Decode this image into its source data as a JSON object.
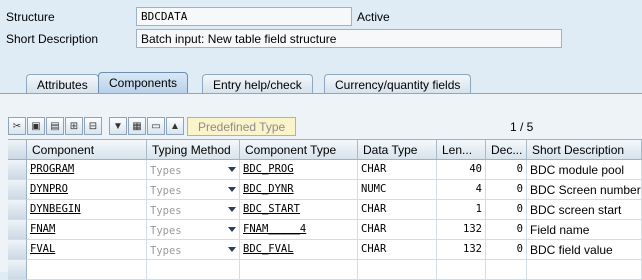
{
  "header": {
    "structure_label": "Structure",
    "structure_value": "BDCDATA",
    "status": "Active",
    "short_desc_label": "Short Description",
    "short_desc_value": "Batch input: New table field structure"
  },
  "tabs": [
    {
      "label": "Attributes",
      "active": false
    },
    {
      "label": "Components",
      "active": true
    },
    {
      "label": "Entry help/check",
      "active": false
    },
    {
      "label": "Currency/quantity fields",
      "active": false
    }
  ],
  "toolbar": {
    "icons": [
      "cut-icon",
      "copy-icon",
      "paste-icon",
      "insert-row-icon",
      "delete-row-icon",
      "expand-icon",
      "select-all-icon",
      "deselect-icon",
      "collapse-icon"
    ],
    "predefined_type_label": "Predefined Type",
    "pager": "1 / 5"
  },
  "table": {
    "columns": [
      "Component",
      "Typing Method",
      "Component Type",
      "Data Type",
      "Len...",
      "Dec...",
      "Short Description"
    ],
    "rows": [
      {
        "component": "PROGRAM",
        "typing": "Types",
        "ctype": "BDC_PROG",
        "dtype": "CHAR",
        "len": "40",
        "dec": "0",
        "desc": "BDC module pool"
      },
      {
        "component": "DYNPRO",
        "typing": "Types",
        "ctype": "BDC_DYNR",
        "dtype": "NUMC",
        "len": "4",
        "dec": "0",
        "desc": "BDC Screen number"
      },
      {
        "component": "DYNBEGIN",
        "typing": "Types",
        "ctype": "BDC_START",
        "dtype": "CHAR",
        "len": "1",
        "dec": "0",
        "desc": "BDC screen start"
      },
      {
        "component": "FNAM",
        "typing": "Types",
        "ctype": "FNAM_____4",
        "dtype": "CHAR",
        "len": "132",
        "dec": "0",
        "desc": "Field name"
      },
      {
        "component": "FVAL",
        "typing": "Types",
        "ctype": "BDC_FVAL",
        "dtype": "CHAR",
        "len": "132",
        "dec": "0",
        "desc": "BDC field value"
      }
    ]
  },
  "colors": {
    "background": "#dfebf5",
    "active_tab": "#b7d0e8",
    "predefined_bg": "#fbf3c9"
  }
}
